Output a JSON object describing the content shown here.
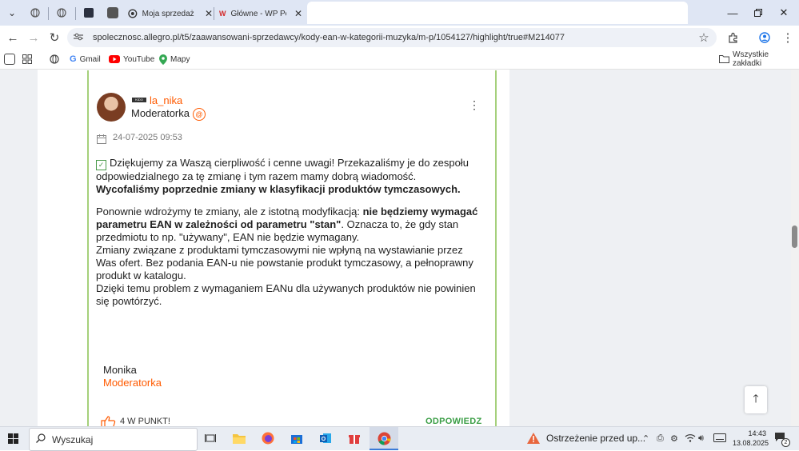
{
  "browser": {
    "tabs": [
      {
        "title": "Moja sprzedaż |",
        "active": false
      },
      {
        "title": "Główne - WP Po",
        "active": false
      }
    ],
    "omnibox": {
      "url": "spolecznosc.allegro.pl/t5/zaawansowani-sprzedawcy/kody-ean-w-kategorii-muzyka/m-p/1054127/highlight/true#M214077"
    },
    "bookmarks": [
      {
        "label": "Gmail"
      },
      {
        "label": "YouTube"
      },
      {
        "label": "Mapy"
      }
    ],
    "all_bookmarks_label": "Wszystkie zakładki"
  },
  "post": {
    "rank_badge": "KIDO",
    "author": "la_nika",
    "role": "Moderatorka",
    "date": "24-07-2025 09:53",
    "para1_line1": "Dziękujemy za Waszą cierpliwość i cenne uwagi! Przekazaliśmy je do zespołu odpowiedzialnego za tę zmianę i tym razem mamy dobrą wiadomość.",
    "para1_bold": "Wycofaliśmy poprzednie zmiany w klasyfikacji produktów tymczasowych.",
    "para2_pre": "Ponownie wdrożymy te zmiany, ale z istotną modyfikacją: ",
    "para2_bold": "nie będziemy wymagać parametru EAN w zależności od parametru \"stan\"",
    "para2_post": ". Oznacza to, że gdy stan przedmiotu to np. \"używany\", EAN nie będzie wymagany.",
    "para2_line2": "Zmiany związane z produktami tymczasowymi nie wpłyną na wystawianie przez Was ofert. Bez podania EAN-u nie powstanie produkt tymczasowy, a pełnoprawny produkt w katalogu.",
    "para2_line3": "Dzięki temu problem z wymaganiem EANu dla używanych produktów nie powinien się powtórzyć.",
    "signature_name": "Monika",
    "signature_role": "Moderatorka",
    "kudos": "4 W PUNKT!",
    "reply": "ODPOWIEDZ"
  },
  "taskbar": {
    "search_placeholder": "Wyszukaj",
    "notification": "Ostrzeżenie przed up...",
    "time": "14:43",
    "date": "13.08.2025",
    "badge": "2"
  },
  "colors": {
    "accent_orange": "#ff5a00",
    "post_border": "#a5d07b",
    "reply_green": "#3b9e46"
  }
}
